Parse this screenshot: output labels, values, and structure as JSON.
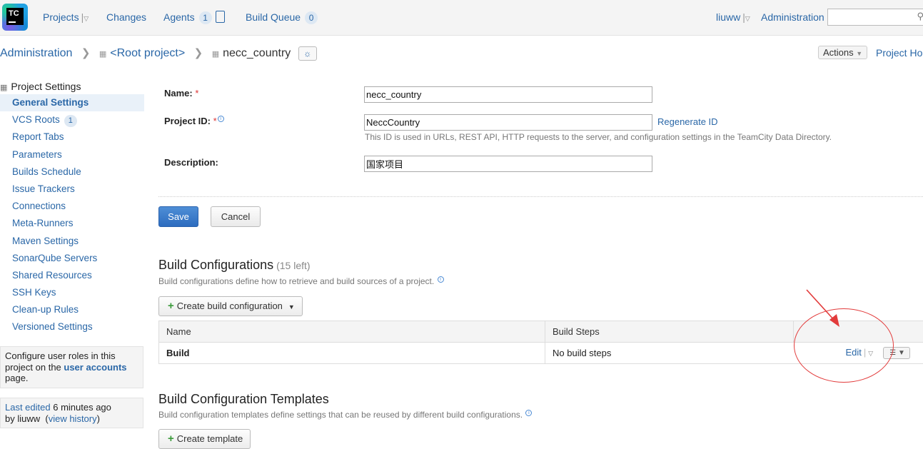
{
  "header": {
    "logo_text": "TC",
    "nav": {
      "projects": "Projects",
      "changes": "Changes",
      "agents": "Agents",
      "agents_count": "1",
      "build_queue": "Build Queue",
      "build_queue_count": "0"
    },
    "user": "liuww",
    "administration": "Administration",
    "search": {
      "value": "",
      "placeholder": ""
    }
  },
  "breadcrumb": {
    "items": [
      "Administration",
      "<Root project>"
    ],
    "current": "necc_country"
  },
  "top_right": {
    "actions": "Actions",
    "project_home": "Project Home"
  },
  "sidebar": {
    "heading": "Project Settings",
    "items": [
      {
        "label": "General Settings"
      },
      {
        "label": "VCS Roots",
        "count": "1"
      },
      {
        "label": "Report Tabs"
      },
      {
        "label": "Parameters"
      },
      {
        "label": "Builds Schedule"
      },
      {
        "label": "Issue Trackers"
      },
      {
        "label": "Connections"
      },
      {
        "label": "Meta-Runners"
      },
      {
        "label": "Maven Settings"
      },
      {
        "label": "SonarQube Servers"
      },
      {
        "label": "Shared Resources"
      },
      {
        "label": "SSH Keys"
      },
      {
        "label": "Clean-up Rules"
      },
      {
        "label": "Versioned Settings"
      }
    ],
    "roles_note": {
      "text_before": "Configure user roles in this project on the ",
      "link": "user accounts",
      "text_after": " page."
    },
    "history": {
      "last_edited": "Last edited",
      "time": " 6 minutes ago",
      "by": "by liuww",
      "open_paren": "(",
      "view_history": "view history",
      "close_paren": ")"
    }
  },
  "form": {
    "name_label": "Name:",
    "name_value": "necc_country",
    "id_label": "Project ID:",
    "id_value": "NeccCountry",
    "regenerate": "Regenerate ID",
    "id_hint": "This ID is used in URLs, REST API, HTTP requests to the server, and configuration settings in the TeamCity Data Directory.",
    "desc_label": "Description:",
    "desc_value": "国家项目",
    "required_mark": "*",
    "save": "Save",
    "cancel": "Cancel"
  },
  "build_configs": {
    "title": "Build Configurations",
    "left": "(15 left)",
    "desc": "Build configurations define how to retrieve and build sources of a project.",
    "create": "Create build configuration",
    "columns": [
      "Name",
      "Build Steps"
    ],
    "rows": [
      {
        "name": "Build",
        "steps": "No build steps",
        "edit": "Edit"
      }
    ]
  },
  "templates": {
    "title": "Build Configuration Templates",
    "desc": "Build configuration templates define settings that can be reused by different build configurations.",
    "create": "Create template"
  },
  "colors": {
    "link": "#2a67a7",
    "annotation": "#e23b3b",
    "primary_button": "#2d6cbf"
  }
}
